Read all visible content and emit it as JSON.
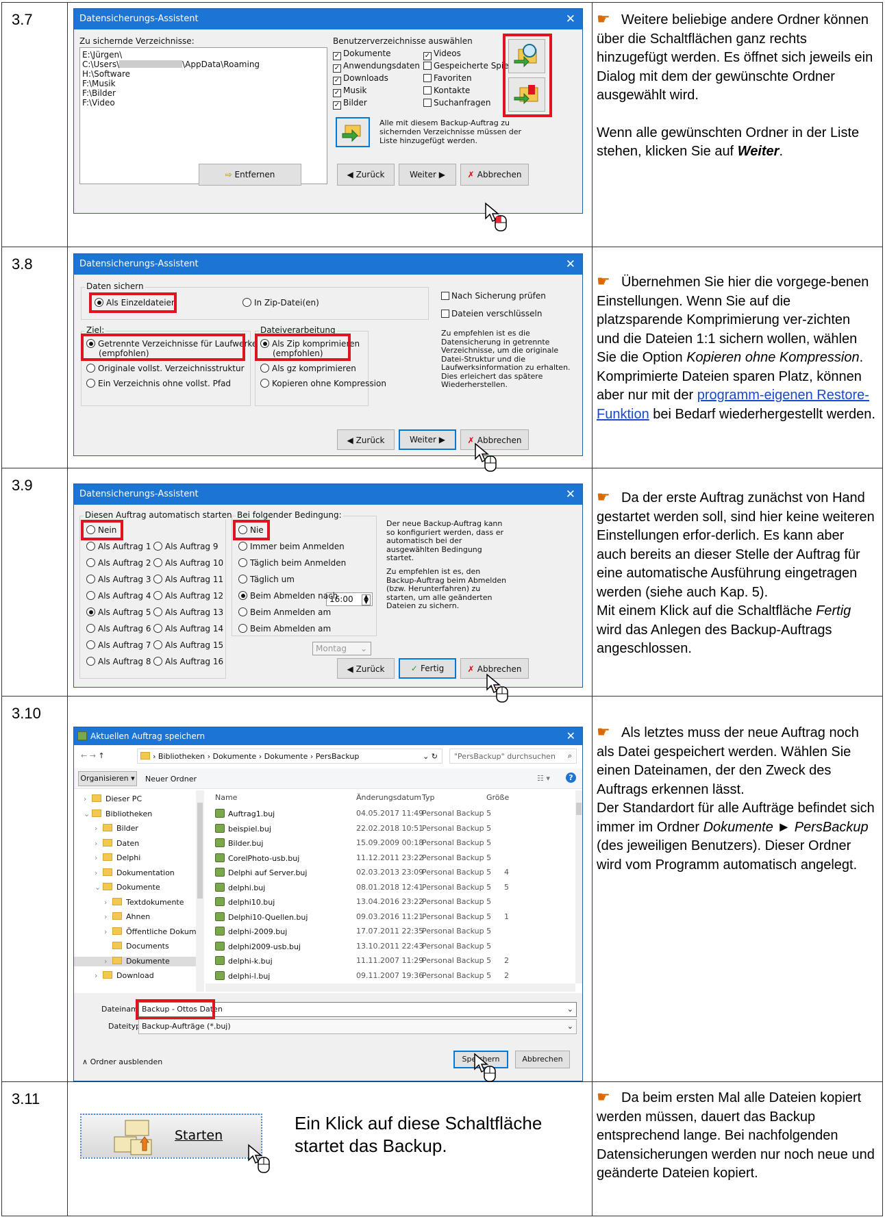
{
  "steps": [
    {
      "num": "3.7",
      "notes": {
        "p1": "Weitere beliebige andere Ordner können über die Schaltflächen ganz rechts hinzugefügt werden. Es öffnet sich jeweils ein Dialog mit dem der gewünschte Ordner ausgewählt wird.",
        "p2_a": "Wenn alle gewünschten Ordner in der Liste stehen, klicken Sie auf ",
        "p2_b": "Weiter",
        "p2_c": "."
      }
    },
    {
      "num": "3.8",
      "notes": {
        "a": "Übernehmen Sie hier die vorgege-benen Einstellungen. Wenn Sie auf die platzsparende Komprimierung ver-zichten und die Dateien 1:1 sichern wollen, wählen Sie die Option ",
        "b": "Kopieren ohne Kompression",
        "c": ". Komprimierte Dateien sparen Platz, können aber nur mit der ",
        "link": "programm-eigenen Restore-Funktion",
        "d": " bei Bedarf wiederhergestellt werden."
      }
    },
    {
      "num": "3.9",
      "notes": {
        "a": "Da der erste Auftrag zunächst von Hand gestartet werden soll, sind hier keine weiteren Einstellungen erfor-derlich. Es kann aber auch bereits an dieser Stelle der Auftrag für eine automatische Ausführung eingetragen werden (siehe auch Kap. 5).",
        "b": "Mit einem Klick auf die Schaltfläche ",
        "c": "Fertig",
        "d": " wird das Anlegen des Backup-Auftrags angeschlossen."
      }
    },
    {
      "num": "3.10",
      "notes": {
        "a": "Als letztes muss der neue Auftrag noch als Datei gespeichert werden. Wählen Sie einen Dateinamen, der den Zweck des Auftrags erkennen lässt.",
        "b": "Der Standardort für alle Aufträge befindet sich immer im Ordner ",
        "c": "Dokumente ► PersBackup",
        "d": " (des jeweiligen Benutzers). Dieser Ordner wird vom Programm automatisch angelegt."
      }
    },
    {
      "num": "3.11",
      "mid": "Ein Klick auf diese Schaltfläche startet das Backup.",
      "button": "Starten",
      "notes": {
        "a": "Da beim ersten Mal alle Dateien kopiert werden müssen, dauert das Backup entsprechend lange. Bei nachfolgenden Datensicherungen werden nur noch neue und geänderte Dateien kopiert."
      }
    }
  ],
  "dlg1": {
    "title": "Datensicherungs-Assistent",
    "close": "✕",
    "dirs_label": "Zu sichernde Verzeichnisse:",
    "dirs": [
      "E:\\Jürgen\\",
      "C:\\Users\\",
      "H:\\Software",
      "F:\\Musik",
      "F:\\Bilder",
      "F:\\Video"
    ],
    "dir2_suffix": "\\AppData\\Roaming",
    "user_label": "Benutzerverzeichnisse auswählen",
    "checks_col1": [
      {
        "label": "Dokumente",
        "on": true
      },
      {
        "label": "Anwendungsdaten",
        "on": true
      },
      {
        "label": "Downloads",
        "on": true
      },
      {
        "label": "Musik",
        "on": true
      },
      {
        "label": "Bilder",
        "on": true
      }
    ],
    "checks_col2": [
      {
        "label": "Videos",
        "on": true
      },
      {
        "label": "Gespeicherte Spiele",
        "on": false
      },
      {
        "label": "Favoriten",
        "on": false
      },
      {
        "label": "Kontakte",
        "on": false
      },
      {
        "label": "Suchanfragen",
        "on": false
      }
    ],
    "hint": "Alle mit diesem Backup-Auftrag zu sichernden Verzeichnisse müssen der Liste hinzugefügt werden.",
    "remove": "Entfernen",
    "back": "Zurück",
    "next": "Weiter",
    "cancel": "Abbrechen"
  },
  "dlg2": {
    "title": "Datensicherungs-Assistent",
    "close": "✕",
    "save_group": "Daten sichern",
    "opt_single": "Als Einzeldateien",
    "opt_zip": "In Zip-Datei(en)",
    "chk_verify": "Nach Sicherung prüfen",
    "chk_encrypt": "Dateien verschlüsseln",
    "target_group": "Ziel:",
    "target1a": "Getrennte Verzeichnisse für Laufwerke",
    "target1b": "(empfohlen)",
    "target2": "Originale vollst. Verzeichnisstruktur",
    "target3": "Ein Verzeichnis ohne vollst. Pfad",
    "proc_group": "Dateiverarbeitung",
    "proc1a": "Als Zip komprimieren",
    "proc1b": "(empfohlen)",
    "proc2": "Als gz komprimieren",
    "proc3": "Kopieren ohne Kompression",
    "hint": "Zu empfehlen ist es die Datensicherung in getrennte Verzeichnisse, um die originale Datei-Struktur und die Laufwerksinformation zu erhalten. Dies erleichert das spätere Wiederherstellen.",
    "back": "Zurück",
    "next": "Weiter",
    "cancel": "Abbrechen"
  },
  "dlg3": {
    "title": "Datensicherungs-Assistent",
    "close": "✕",
    "auto_group": "Diesen Auftrag automatisch starten",
    "none": "Nein",
    "col1": [
      "Als Auftrag 1",
      "Als Auftrag 2",
      "Als Auftrag 3",
      "Als Auftrag 4",
      "Als Auftrag 5",
      "Als Auftrag 6",
      "Als Auftrag 7",
      "Als Auftrag 8"
    ],
    "col2": [
      "Als Auftrag 9",
      "Als Auftrag 10",
      "Als Auftrag 11",
      "Als Auftrag 12",
      "Als Auftrag 13",
      "Als Auftrag 14",
      "Als Auftrag 15",
      "Als Auftrag 16"
    ],
    "selected_auftrag": "Als Auftrag 5",
    "cond_group": "Bei folgender Bedingung:",
    "cond": [
      "Nie",
      "Immer beim Anmelden",
      "Täglich beim Anmelden",
      "Täglich um",
      "Beim Abmelden nach",
      "Beim Anmelden am",
      "Beim Abmelden am"
    ],
    "selected_cond": "Beim Abmelden nach",
    "time": "16:00",
    "weekday": "Montag",
    "hint1": "Der neue Backup-Auftrag kann so konfiguriert werden, dass er automatisch bei der ausgewählten Bedingung startet.",
    "hint2": "Zu empfehlen ist es, den Backup-Auftrag beim Abmelden (bzw. Herunterfahren) zu starten, um alle geänderten Dateien zu sichern.",
    "back": "Zurück",
    "finish": "Fertig",
    "cancel": "Abbrechen"
  },
  "dlg4": {
    "title": "Aktuellen Auftrag speichern",
    "close": "✕",
    "crumbs": "›  Bibliotheken  ›  Dokumente  ›  Dokumente  ›  PersBackup",
    "search": "\"PersBackup\" durchsuchen",
    "organize": "Organisieren ▾",
    "new_folder": "Neuer Ordner",
    "tree": [
      "Dieser PC",
      "Bibliotheken",
      "Bilder",
      "Daten",
      "Delphi",
      "Dokumentation",
      "Dokumente",
      "Textdokumente",
      "Ahnen",
      "Öffentliche Dokumente",
      "Documents",
      "Dokumente",
      "Download"
    ],
    "cols": {
      "name": "Name",
      "date": "Änderungsdatum",
      "type": "Typ",
      "size": "Größe"
    },
    "files": [
      {
        "name": "Auftrag1.buj",
        "date": "04.05.2017 11:49",
        "type": "Personal Backup 5",
        "size": ""
      },
      {
        "name": "beispiel.buj",
        "date": "22.02.2018 10:51",
        "type": "Personal Backup 5",
        "size": ""
      },
      {
        "name": "Bilder.buj",
        "date": "15.09.2009 00:18",
        "type": "Personal Backup 5",
        "size": ""
      },
      {
        "name": "CorelPhoto-usb.buj",
        "date": "11.12.2011 23:22",
        "type": "Personal Backup 5",
        "size": ""
      },
      {
        "name": "Delphi auf Server.buj",
        "date": "02.03.2013 23:09",
        "type": "Personal Backup 5",
        "size": "4"
      },
      {
        "name": "delphi.buj",
        "date": "08.01.2018 12:41",
        "type": "Personal Backup 5",
        "size": "5"
      },
      {
        "name": "delphi10.buj",
        "date": "13.04.2016 23:22",
        "type": "Personal Backup 5",
        "size": ""
      },
      {
        "name": "Delphi10-Quellen.buj",
        "date": "09.03.2016 11:21",
        "type": "Personal Backup 5",
        "size": "1"
      },
      {
        "name": "delphi-2009.buj",
        "date": "17.07.2011 22:35",
        "type": "Personal Backup 5",
        "size": ""
      },
      {
        "name": "delphi2009-usb.buj",
        "date": "13.10.2011 22:43",
        "type": "Personal Backup 5",
        "size": ""
      },
      {
        "name": "delphi-k.buj",
        "date": "11.11.2007 11:29",
        "type": "Personal Backup 5",
        "size": "2"
      },
      {
        "name": "delphi-l.buj",
        "date": "09.11.2007 19:36",
        "type": "Personal Backup 5",
        "size": "2"
      }
    ],
    "filename_label": "Dateiname:",
    "filename": "Backup - Ottos Daten",
    "filetype_label": "Dateityp:",
    "filetype": "Backup-Aufträge (*.buj)",
    "hide": "Ordner ausblenden",
    "save": "Speichern",
    "cancel": "Abbrechen"
  },
  "colors": {
    "accent": "#1c74d4",
    "highlight": "#e0141e",
    "link": "#1a49c9",
    "hand": "#d86a00"
  }
}
